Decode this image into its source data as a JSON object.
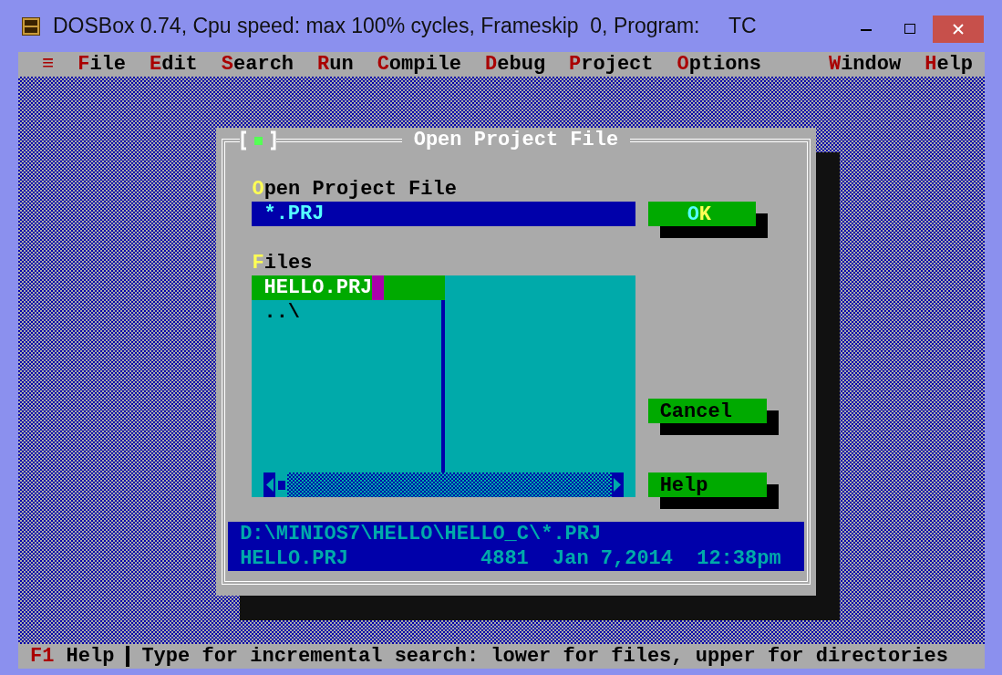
{
  "window": {
    "title": "DOSBox 0.74, Cpu speed: max 100% cycles, Frameskip  0, Program:     TC"
  },
  "menu": {
    "system": "≡",
    "items": [
      "File",
      "Edit",
      "Search",
      "Run",
      "Compile",
      "Debug",
      "Project",
      "Options"
    ],
    "right_items": [
      "Window",
      "Help"
    ]
  },
  "dialog": {
    "title": "Open Project File",
    "name_label": "Open Project File",
    "name_value": "*.PRJ",
    "files_label": "Files",
    "files": [
      {
        "name": "HELLO.PRJ",
        "selected": true
      },
      {
        "name": "..\\",
        "selected": false
      }
    ],
    "buttons": [
      {
        "label": "OK",
        "default": true
      },
      {
        "label": "Cancel",
        "default": false
      },
      {
        "label": "Help",
        "default": false
      }
    ],
    "info": {
      "path": "D:\\MINIOS7\\HELLO\\HELLO_C\\*.PRJ",
      "file": "HELLO.PRJ",
      "size": "4881",
      "date": "Jan 7,2014",
      "time": "12:38pm"
    }
  },
  "status_bar": {
    "key": "F1",
    "key_label": "Help",
    "message": "Type for incremental search: lower for files, upper for directories"
  }
}
